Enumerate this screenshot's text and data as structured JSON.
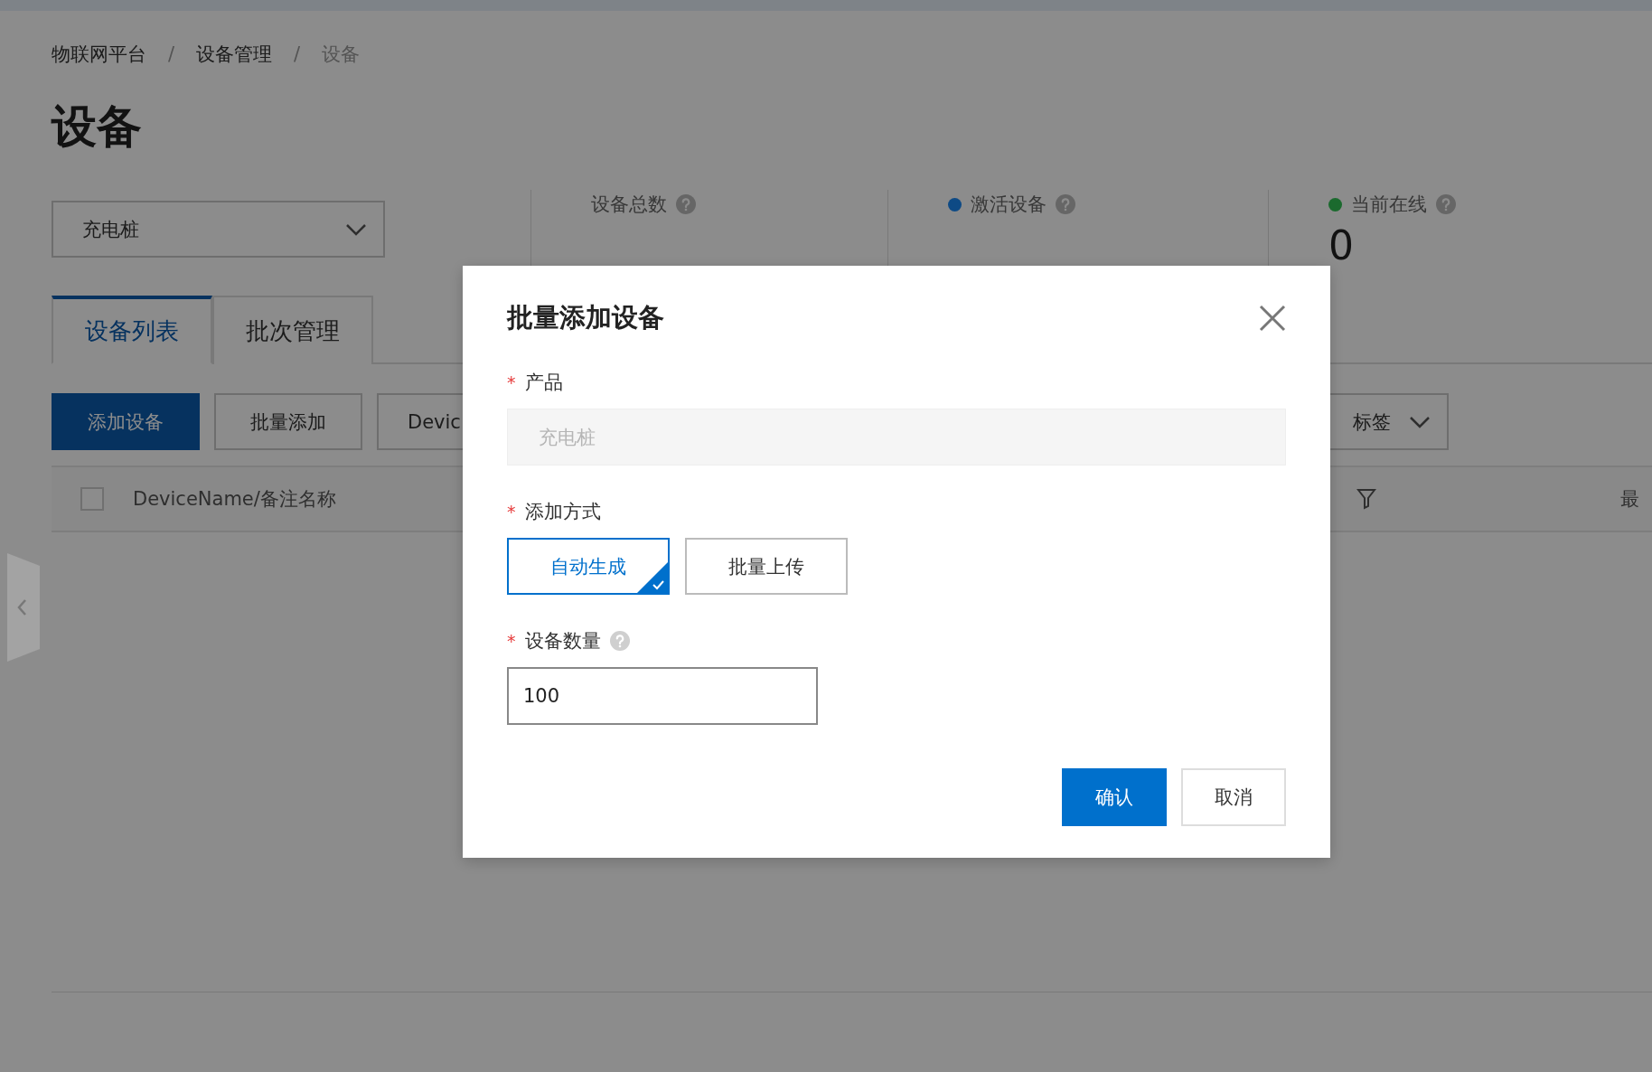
{
  "breadcrumb": {
    "separator": "/",
    "items": [
      {
        "label": "物联网平台"
      },
      {
        "label": "设备管理"
      },
      {
        "label": "设备"
      }
    ]
  },
  "page_title": "设备",
  "product_select": {
    "value": "充电桩"
  },
  "stats": [
    {
      "label": "设备总数"
    },
    {
      "label": "激活设备",
      "color": "#0e4a85"
    },
    {
      "label": "当前在线",
      "value": "0",
      "color": "#1b6a2e"
    }
  ],
  "tabs": [
    {
      "label": "设备列表",
      "selected": true
    },
    {
      "label": "批次管理",
      "selected": false
    }
  ],
  "toolbar": {
    "buttons": [
      {
        "label": "添加设备",
        "kind": "primary"
      },
      {
        "label": "批量添加",
        "kind": "default"
      },
      {
        "label": "Devic",
        "kind": "default"
      }
    ],
    "tag_select": {
      "value": "标签"
    }
  },
  "table": {
    "select_all": {
      "checked": false
    },
    "columns": [
      {
        "label": "DeviceName/备注名称"
      },
      {
        "filterable": true
      },
      {
        "label": "最"
      }
    ]
  },
  "modal": {
    "title": "批量添加设备",
    "fields": [
      {
        "kind": "readonly",
        "required_mark": "*",
        "label": "产品",
        "value": "充电桩"
      },
      {
        "kind": "choice",
        "required_mark": "*",
        "label": "添加方式",
        "options": [
          {
            "label": "自动生成",
            "selected": true
          },
          {
            "label": "批量上传",
            "selected": false
          }
        ]
      },
      {
        "kind": "input",
        "required_mark": "*",
        "label": "设备数量",
        "help": true,
        "value": "100"
      }
    ],
    "buttons": [
      {
        "label": "确认",
        "kind": "primary"
      },
      {
        "label": "取消",
        "kind": "default"
      }
    ]
  }
}
